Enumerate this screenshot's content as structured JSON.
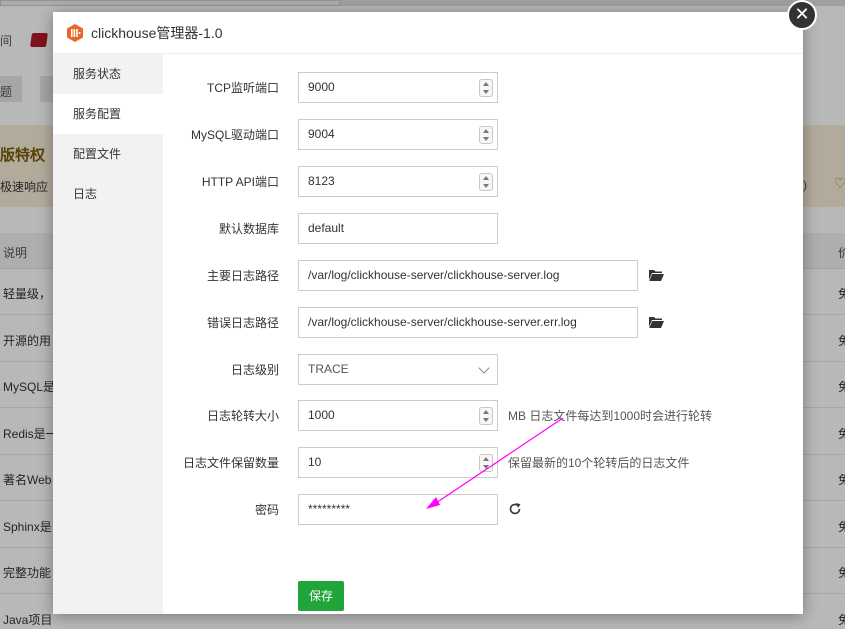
{
  "background": {
    "nav_fragment": "间",
    "button_fragment": "题",
    "banner_title": "版特权",
    "banner_subtitle": "极速响应",
    "banner_right": ")",
    "table_header": "说明",
    "table_header_right": "价",
    "rows": [
      "轻量级，",
      "开源的用",
      "MySQL是",
      "Redis是一",
      "著名Web",
      "Sphinx是",
      "完整功能",
      "Java项目"
    ],
    "row_right": "免"
  },
  "dialog": {
    "title": "clickhouse管理器-1.0",
    "close_label": "✕",
    "sidebar": [
      "服务状态",
      "服务配置",
      "配置文件",
      "日志"
    ],
    "active_index": 1,
    "form": {
      "tcp_port": {
        "label": "TCP监听端口",
        "value": "9000"
      },
      "mysql_port": {
        "label": "MySQL驱动端口",
        "value": "9004"
      },
      "http_port": {
        "label": "HTTP API端口",
        "value": "8123"
      },
      "default_db": {
        "label": "默认数据库",
        "value": "default"
      },
      "main_log": {
        "label": "主要日志路径",
        "value": "/var/log/clickhouse-server/clickhouse-server.log"
      },
      "error_log": {
        "label": "错误日志路径",
        "value": "/var/log/clickhouse-server/clickhouse-server.err.log"
      },
      "log_level": {
        "label": "日志级别",
        "value": "TRACE"
      },
      "log_rotate": {
        "label": "日志轮转大小",
        "value": "1000",
        "hint": "MB 日志文件每达到1000时会进行轮转"
      },
      "log_keep": {
        "label": "日志文件保留数量",
        "value": "10",
        "hint": "保留最新的10个轮转后的日志文件"
      },
      "password": {
        "label": "密码",
        "value": "*********"
      }
    },
    "save_label": "保存"
  },
  "colors": {
    "accent_green": "#20a53a",
    "annotation_arrow": "#ff00ff",
    "logo_orange": "#e8672a"
  }
}
